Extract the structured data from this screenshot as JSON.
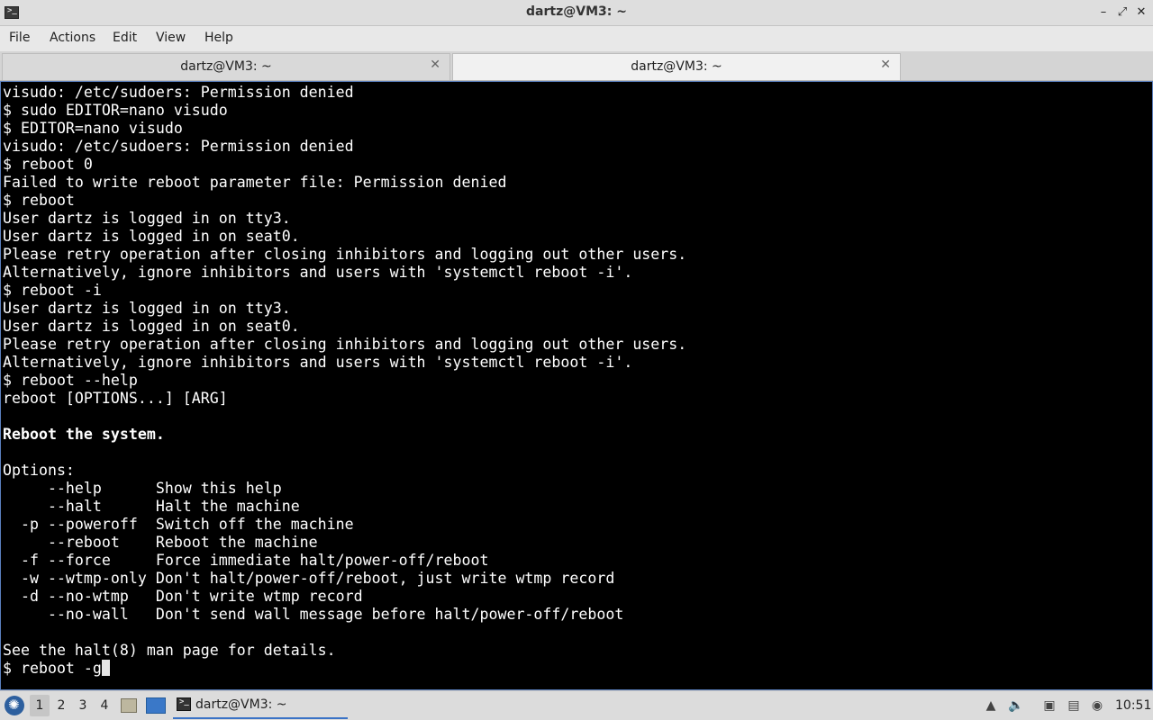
{
  "window": {
    "title": "dartz@VM3: ~"
  },
  "menu": [
    "File",
    "Actions",
    "Edit",
    "View",
    "Help"
  ],
  "tabs": [
    {
      "label": "dartz@VM3: ~",
      "active": false
    },
    {
      "label": "dartz@VM3: ~",
      "active": true
    }
  ],
  "terminal": {
    "lines": [
      "visudo: /etc/sudoers: Permission denied",
      "$ sudo EDITOR=nano visudo",
      "$ EDITOR=nano visudo",
      "visudo: /etc/sudoers: Permission denied",
      "$ reboot 0",
      "Failed to write reboot parameter file: Permission denied",
      "$ reboot",
      "User dartz is logged in on tty3.",
      "User dartz is logged in on seat0.",
      "Please retry operation after closing inhibitors and logging out other users.",
      "Alternatively, ignore inhibitors and users with 'systemctl reboot -i'.",
      "$ reboot -i",
      "User dartz is logged in on tty3.",
      "User dartz is logged in on seat0.",
      "Please retry operation after closing inhibitors and logging out other users.",
      "Alternatively, ignore inhibitors and users with 'systemctl reboot -i'.",
      "$ reboot --help",
      "reboot [OPTIONS...] [ARG]",
      "",
      "Reboot the system.",
      "",
      "Options:",
      "     --help      Show this help",
      "     --halt      Halt the machine",
      "  -p --poweroff  Switch off the machine",
      "     --reboot    Reboot the machine",
      "  -f --force     Force immediate halt/power-off/reboot",
      "  -w --wtmp-only Don't halt/power-off/reboot, just write wtmp record",
      "  -d --no-wtmp   Don't write wtmp record",
      "     --no-wall   Don't send wall message before halt/power-off/reboot",
      "",
      "See the halt(8) man page for details."
    ],
    "bold_line_index": 19,
    "prompt_line": "$ reboot -g"
  },
  "taskbar": {
    "workspaces": [
      "1",
      "2",
      "3",
      "4"
    ],
    "active_workspace": "1",
    "task_label": "dartz@VM3: ~",
    "clock": "10:51"
  },
  "icons": {
    "app": "terminal-icon",
    "start": "start-menu-icon",
    "file_manager": "folder-icon",
    "desktop": "show-desktop-icon",
    "tray": [
      "upload-icon",
      "volume-icon",
      "network-icon",
      "clipboard-icon",
      "update-icon"
    ]
  }
}
